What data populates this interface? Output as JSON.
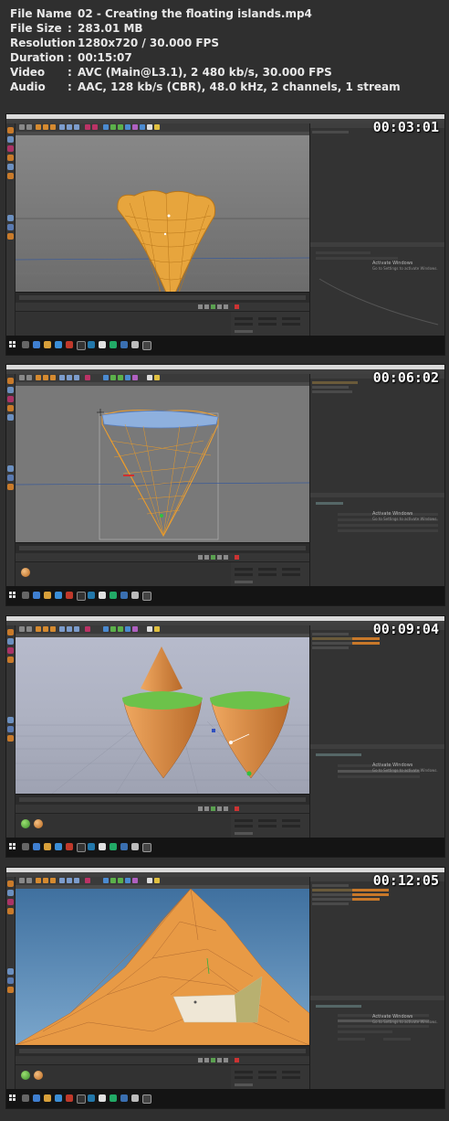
{
  "file_info": [
    {
      "key": "File Name",
      "value": "02 - Creating the floating islands.mp4"
    },
    {
      "key": "File Size",
      "value": "283.01 MB"
    },
    {
      "key": "Resolution",
      "value": "1280x720 / 30.000 FPS"
    },
    {
      "key": "Duration",
      "value": "00:15:07"
    },
    {
      "key": "Video",
      "value": "AVC (Main@L3.1), 2 480 kb/s, 30.000 FPS"
    },
    {
      "key": "Audio",
      "value": "AAC, 128 kb/s (CBR), 48.0 kHz, 2 channels, 1 stream"
    }
  ],
  "separator": ":",
  "frames": [
    {
      "timestamp": "00:03:01"
    },
    {
      "timestamp": "00:06:02"
    },
    {
      "timestamp": "00:09:04"
    },
    {
      "timestamp": "00:12:05"
    }
  ],
  "windows_watermark": {
    "title": "Activate Windows",
    "subtitle": "Go to Settings to activate Windows."
  },
  "colors": {
    "background": "#2f2f2f",
    "island_orange": "#e89a45",
    "grass_green": "#6cc24a",
    "wire_blue": "#7aa8e0",
    "sky_blue": "#5f8ec0"
  },
  "icons": [
    "windows-start-icon",
    "c4d-toolbar-icons",
    "material-ball-icon"
  ]
}
